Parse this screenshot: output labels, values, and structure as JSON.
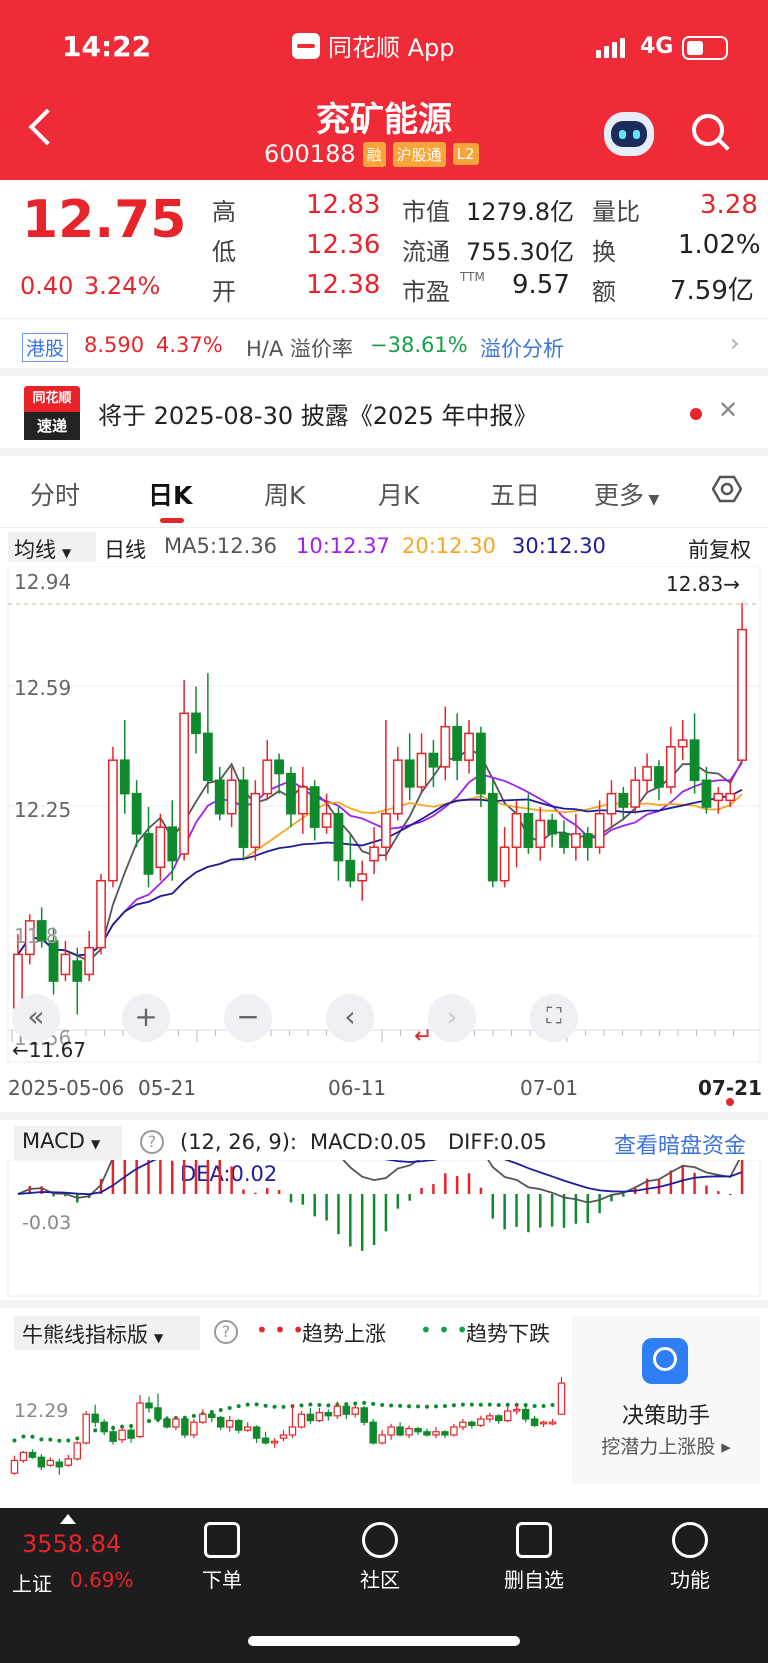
{
  "status": {
    "time": "14:22",
    "app_name": "同花顺 App",
    "network": "4G"
  },
  "header": {
    "title": "兖矿能源",
    "code": "600188",
    "tags": [
      "融",
      "沪股通",
      "L2"
    ]
  },
  "quote": {
    "price": "12.75",
    "change": "0.40",
    "change_pct": "3.24%",
    "high_label": "高",
    "high": "12.83",
    "low_label": "低",
    "low": "12.36",
    "open_label": "开",
    "open": "12.38",
    "mcap_label": "市值",
    "mcap": "1279.8亿",
    "float_label": "流通",
    "float": "755.30亿",
    "pe_label": "市盈",
    "pe_sup": "TTM",
    "pe": "9.57",
    "vol_ratio_label": "量比",
    "vol_ratio": "3.28",
    "turnover_label": "换",
    "turnover": "1.02%",
    "amount_label": "额",
    "amount": "7.59亿"
  },
  "hk": {
    "tag": "港股",
    "price": "8.590",
    "pct": "4.37%",
    "premium_label": "H/A 溢价率",
    "premium": "−38.61%",
    "link": "溢价分析"
  },
  "news": {
    "logo_top": "同花顺",
    "logo_bottom": "速递",
    "text": "将于 2025-08-30 披露《2025 年中报》"
  },
  "tabs": [
    "分时",
    "日K",
    "周K",
    "月K",
    "五日",
    "更多"
  ],
  "ma": {
    "dropdown": "均线",
    "period": "日线",
    "ma5": "MA5:12.36",
    "ma10": "10:12.37",
    "ma20": "20:12.30",
    "ma30": "30:12.30",
    "adjust": "前复权",
    "colors": {
      "ma5": "#555555",
      "ma10": "#a020f0",
      "ma20": "#f5a623",
      "ma30": "#1c1c9c"
    }
  },
  "kchart": {
    "y_labels": [
      "12.94",
      "12.59",
      "12.25",
      "11.8",
      "11.56"
    ],
    "high_marker": "12.83→",
    "low_marker": "←11.67",
    "dates": [
      "2025-05-06",
      "05-21",
      "06-11",
      "07-01",
      "07-21"
    ],
    "ylim": [
      11.56,
      12.94
    ]
  },
  "chart_data": {
    "type": "candlestick",
    "title": "兖矿能源 日K",
    "ylim": [
      11.56,
      12.94
    ],
    "x_start": "2025-05-06",
    "x_end": "07-21",
    "candles": [
      [
        11.62,
        11.78,
        11.6,
        11.84
      ],
      [
        11.78,
        11.88,
        11.75,
        11.9
      ],
      [
        11.88,
        11.82,
        11.8,
        11.92
      ],
      [
        11.82,
        11.7,
        11.66,
        11.86
      ],
      [
        11.72,
        11.78,
        11.7,
        11.82
      ],
      [
        11.76,
        11.7,
        11.6,
        11.8
      ],
      [
        11.72,
        11.8,
        11.7,
        11.85
      ],
      [
        11.8,
        12.0,
        11.78,
        12.02
      ],
      [
        12.0,
        12.36,
        11.98,
        12.4
      ],
      [
        12.36,
        12.26,
        12.2,
        12.48
      ],
      [
        12.26,
        12.14,
        12.1,
        12.3
      ],
      [
        12.14,
        12.02,
        11.98,
        12.22
      ],
      [
        12.04,
        12.16,
        12.0,
        12.2
      ],
      [
        12.16,
        12.06,
        12.0,
        12.24
      ],
      [
        12.08,
        12.5,
        12.06,
        12.6
      ],
      [
        12.5,
        12.44,
        12.38,
        12.58
      ],
      [
        12.44,
        12.3,
        12.26,
        12.62
      ],
      [
        12.3,
        12.2,
        12.18,
        12.34
      ],
      [
        12.2,
        12.3,
        12.16,
        12.34
      ],
      [
        12.3,
        12.1,
        12.06,
        12.34
      ],
      [
        12.1,
        12.26,
        12.06,
        12.3
      ],
      [
        12.26,
        12.36,
        12.24,
        12.42
      ],
      [
        12.36,
        12.32,
        12.26,
        12.38
      ],
      [
        12.32,
        12.2,
        12.16,
        12.34
      ],
      [
        12.2,
        12.28,
        12.14,
        12.34
      ],
      [
        12.28,
        12.16,
        12.12,
        12.3
      ],
      [
        12.16,
        12.2,
        12.14,
        12.26
      ],
      [
        12.2,
        12.06,
        12.0,
        12.22
      ],
      [
        12.06,
        12.0,
        11.98,
        12.14
      ],
      [
        12.0,
        12.02,
        11.94,
        12.06
      ],
      [
        12.06,
        12.1,
        12.02,
        12.16
      ],
      [
        12.1,
        12.2,
        12.06,
        12.48
      ],
      [
        12.2,
        12.36,
        12.18,
        12.4
      ],
      [
        12.36,
        12.28,
        12.24,
        12.44
      ],
      [
        12.28,
        12.38,
        12.26,
        12.44
      ],
      [
        12.38,
        12.34,
        12.28,
        12.42
      ],
      [
        12.34,
        12.46,
        12.3,
        12.52
      ],
      [
        12.46,
        12.36,
        12.3,
        12.5
      ],
      [
        12.36,
        12.44,
        12.32,
        12.48
      ],
      [
        12.44,
        12.26,
        12.22,
        12.46
      ],
      [
        12.26,
        12.0,
        11.98,
        12.3
      ],
      [
        12.0,
        12.1,
        11.98,
        12.16
      ],
      [
        12.1,
        12.2,
        12.04,
        12.24
      ],
      [
        12.2,
        12.1,
        12.08,
        12.26
      ],
      [
        12.1,
        12.18,
        12.06,
        12.22
      ],
      [
        12.18,
        12.14,
        12.1,
        12.2
      ],
      [
        12.14,
        12.1,
        12.08,
        12.18
      ],
      [
        12.1,
        12.14,
        12.06,
        12.2
      ],
      [
        12.14,
        12.1,
        12.06,
        12.16
      ],
      [
        12.1,
        12.2,
        12.08,
        12.24
      ],
      [
        12.2,
        12.26,
        12.16,
        12.3
      ],
      [
        12.26,
        12.22,
        12.18,
        12.28
      ],
      [
        12.22,
        12.3,
        12.2,
        12.34
      ],
      [
        12.3,
        12.34,
        12.26,
        12.38
      ],
      [
        12.34,
        12.28,
        12.24,
        12.36
      ],
      [
        12.28,
        12.4,
        12.26,
        12.46
      ],
      [
        12.4,
        12.42,
        12.36,
        12.48
      ],
      [
        12.42,
        12.3,
        12.26,
        12.5
      ],
      [
        12.3,
        12.22,
        12.2,
        12.34
      ],
      [
        12.24,
        12.26,
        12.2,
        12.28
      ],
      [
        12.24,
        12.26,
        12.22,
        12.3
      ],
      [
        12.36,
        12.75,
        12.36,
        12.83
      ]
    ]
  },
  "macd": {
    "dropdown": "MACD",
    "params": "(12, 26, 9):",
    "macd": "MACD:0.05",
    "diff": "DIFF:0.05",
    "dea": "DEA:0.02",
    "link": "查看暗盘资金",
    "y_label": "-0.03"
  },
  "bull": {
    "dropdown": "牛熊线指标版",
    "up_legend": "趋势上涨",
    "down_legend": "趋势下跌",
    "y_label": "12.29"
  },
  "assistant": {
    "title": "决策助手",
    "sub": "挖潜力上涨股"
  },
  "bottom": {
    "index_value": "3558.84",
    "index_name": "上证",
    "index_pct": "0.69%",
    "items": [
      "下单",
      "社区",
      "删自选",
      "功能"
    ]
  }
}
